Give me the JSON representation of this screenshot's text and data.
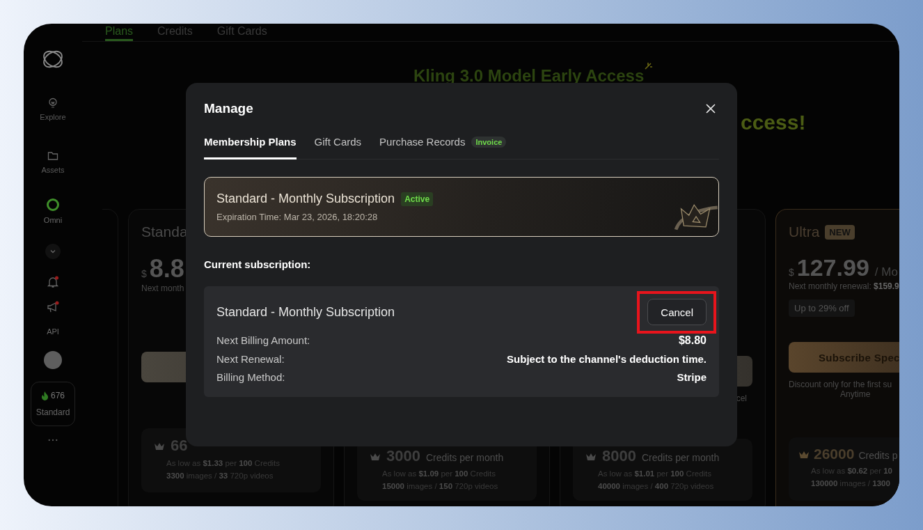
{
  "sidebar": {
    "nav": [
      {
        "label": "Explore"
      },
      {
        "label": "Assets"
      },
      {
        "label": "Omni"
      }
    ],
    "alerts": [
      {
        "unread": true
      },
      {
        "unread": true
      }
    ],
    "api_label": "API",
    "credits": {
      "amount": "676",
      "plan": "Standard"
    }
  },
  "page": {
    "tabs": [
      {
        "label": "Plans",
        "selected": true
      },
      {
        "label": "Credits",
        "selected": false
      },
      {
        "label": "Gift Cards",
        "selected": false
      }
    ],
    "headline": "Kling 3.0 Model Early Access",
    "headline_2": "ccess!",
    "cards": [
      {
        "kind": "standard",
        "title": "Standa",
        "currency": "$",
        "price": "8.8",
        "note": "Next month",
        "credits": "66",
        "lines": [
          "As low as **$1.33** per **100** Credits",
          "**3300** images / **33** 720p videos"
        ]
      },
      {
        "kind": "hidden",
        "credits": "3000",
        "unit": "Credits per month",
        "lines": [
          "As low as **$1.09** per **100** Credits",
          "**15000** images / **150** 720p videos"
        ]
      },
      {
        "kind": "hidden",
        "button": true,
        "footnote": "cel",
        "credits": "8000",
        "unit": "Credits per month",
        "lines": [
          "As low as **$1.01** per **100** Credits",
          "**40000** images / **400** 720p videos"
        ]
      },
      {
        "kind": "ultra",
        "title": "Ultra",
        "badge": "NEW",
        "currency": "$",
        "price": "127.99",
        "per": "/ Mo",
        "renewal": "Next monthly renewal: **$159.9**",
        "discount": "Up to 29% off",
        "button_label": "Subscribe Spec",
        "notes": [
          "Discount only for the first su",
          "Anytime"
        ],
        "credits": "26000",
        "unit": "Credits p",
        "lines": [
          "As low as **$0.62** per **10**",
          "**130000** images / **1300**"
        ]
      }
    ]
  },
  "dialog": {
    "title": "Manage",
    "tabs": [
      {
        "label": "Membership Plans",
        "selected": true
      },
      {
        "label": "Gift Cards",
        "selected": false
      },
      {
        "label": "Purchase Records",
        "selected": false,
        "badge": "Invoice"
      }
    ],
    "plan": {
      "title": "Standard - Monthly Subscription",
      "status": "Active",
      "expiration": "Expiration Time: Mar 23, 2026, 18:20:28"
    },
    "section_title": "Current subscription:",
    "subscription": {
      "title": "Standard - Monthly Subscription",
      "cancel_label": "Cancel",
      "highlighted": true,
      "rows": [
        {
          "label": "Next Billing Amount:",
          "value": "$8.80",
          "emphasis": true
        },
        {
          "label": "Next Renewal:",
          "value": "Subject to the channel's deduction time.",
          "emphasis": false
        },
        {
          "label": "Billing Method:",
          "value": "Stripe",
          "emphasis": false
        }
      ]
    }
  }
}
